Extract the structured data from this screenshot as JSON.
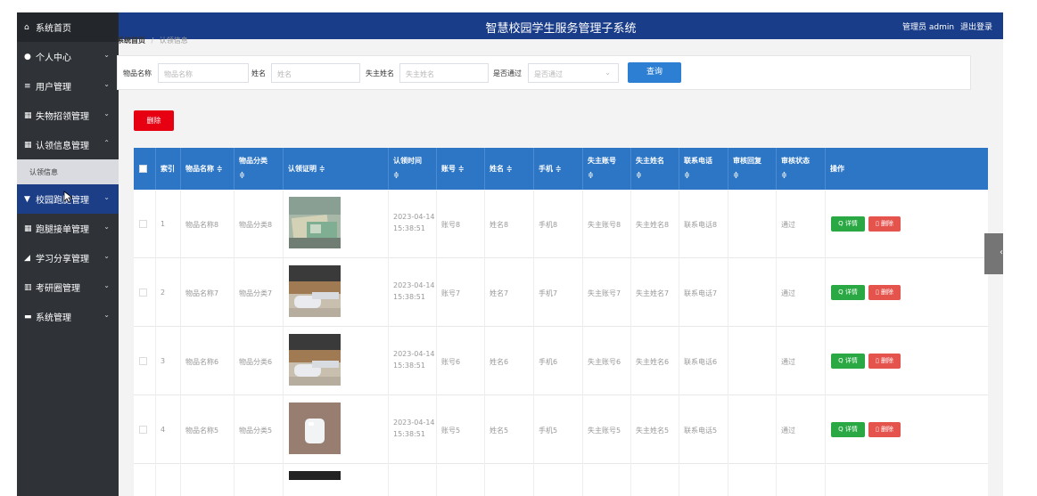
{
  "header": {
    "title": "智慧校园学生服务管理子系统",
    "user_label": "管理员 admin",
    "logout_label": "退出登录"
  },
  "sidebar": {
    "items": [
      {
        "label": "系统首页",
        "icon": "home-icon",
        "glyph": "⌂"
      },
      {
        "label": "个人中心",
        "icon": "user-icon",
        "glyph": "●"
      },
      {
        "label": "用户管理",
        "icon": "list-icon",
        "glyph": "≡"
      },
      {
        "label": "失物招领管理",
        "icon": "grid-icon",
        "glyph": "▦"
      },
      {
        "label": "认领信息管理",
        "icon": "grid-icon",
        "glyph": "▦"
      },
      {
        "label": "认领信息",
        "sub": true
      },
      {
        "label": "校园跑腿管理",
        "icon": "cup-icon",
        "glyph": "▼"
      },
      {
        "label": "跑腿接单管理",
        "icon": "grid-icon",
        "glyph": "▦"
      },
      {
        "label": "学习分享管理",
        "icon": "share-icon",
        "glyph": "◢"
      },
      {
        "label": "考研圈管理",
        "icon": "bar-chart-icon",
        "glyph": "▥"
      },
      {
        "label": "系统管理",
        "icon": "monitor-icon",
        "glyph": "▬"
      }
    ]
  },
  "breadcrumb": {
    "home": "系统首页",
    "current": "认领信息"
  },
  "search": {
    "item_name_label": "物品名称",
    "item_name_placeholder": "物品名称",
    "name_label": "姓名",
    "name_placeholder": "姓名",
    "owner_name_label": "失主姓名",
    "owner_name_placeholder": "失主姓名",
    "passed_label": "是否通过",
    "passed_placeholder": "是否通过",
    "query_button": "查询"
  },
  "toolbar": {
    "delete_label": "删除"
  },
  "table": {
    "headers": {
      "index": "索引",
      "item_name": "物品名称 ≑",
      "category_l1": "物品分类",
      "category_l2": "≑",
      "proof": "认领证明 ≑",
      "time_l1": "认领时间",
      "time_l2": "≑",
      "account": "账号 ≑",
      "name": "姓名 ≑",
      "phone": "手机 ≑",
      "owner_account_l1": "失主账号",
      "owner_account_l2": "≑",
      "owner_name_l1": "失主姓名",
      "owner_name_l2": "≑",
      "contact_l1": "联系电话",
      "contact_l2": "≑",
      "reply_l1": "审核回复",
      "reply_l2": "≑",
      "status_l1": "审核状态",
      "status_l2": "≑",
      "ops": "操作"
    },
    "detail_label": "Q 详情",
    "delete_label": "删除",
    "rows": [
      {
        "index": "1",
        "item_name": "物品名称8",
        "category": "物品分类8",
        "time": "2023-04-14 15:38:51",
        "account": "账号8",
        "name": "姓名8",
        "phone": "手机8",
        "owner_account": "失主账号8",
        "owner_name": "失主姓名8",
        "contact": "联系电话8",
        "reply": "",
        "status": "通过"
      },
      {
        "index": "2",
        "item_name": "物品名称7",
        "category": "物品分类7",
        "time": "2023-04-14 15:38:51",
        "account": "账号7",
        "name": "姓名7",
        "phone": "手机7",
        "owner_account": "失主账号7",
        "owner_name": "失主姓名7",
        "contact": "联系电话7",
        "reply": "",
        "status": "通过"
      },
      {
        "index": "3",
        "item_name": "物品名称6",
        "category": "物品分类6",
        "time": "2023-04-14 15:38:51",
        "account": "账号6",
        "name": "姓名6",
        "phone": "手机6",
        "owner_account": "失主账号6",
        "owner_name": "失主姓名6",
        "contact": "联系电话6",
        "reply": "",
        "status": "通过"
      },
      {
        "index": "4",
        "item_name": "物品名称5",
        "category": "物品分类5",
        "time": "2023-04-14 15:38:51",
        "account": "账号5",
        "name": "姓名5",
        "phone": "手机5",
        "owner_account": "失主账号5",
        "owner_name": "失主姓名5",
        "contact": "联系电话5",
        "reply": "",
        "status": "通过"
      }
    ]
  },
  "colors": {
    "header": "#1a3d8a",
    "sidebar": "#2f3338",
    "table_head": "#2d76c6",
    "detail": "#2aa843",
    "delete": "#e5534d",
    "danger": "#e60012"
  }
}
